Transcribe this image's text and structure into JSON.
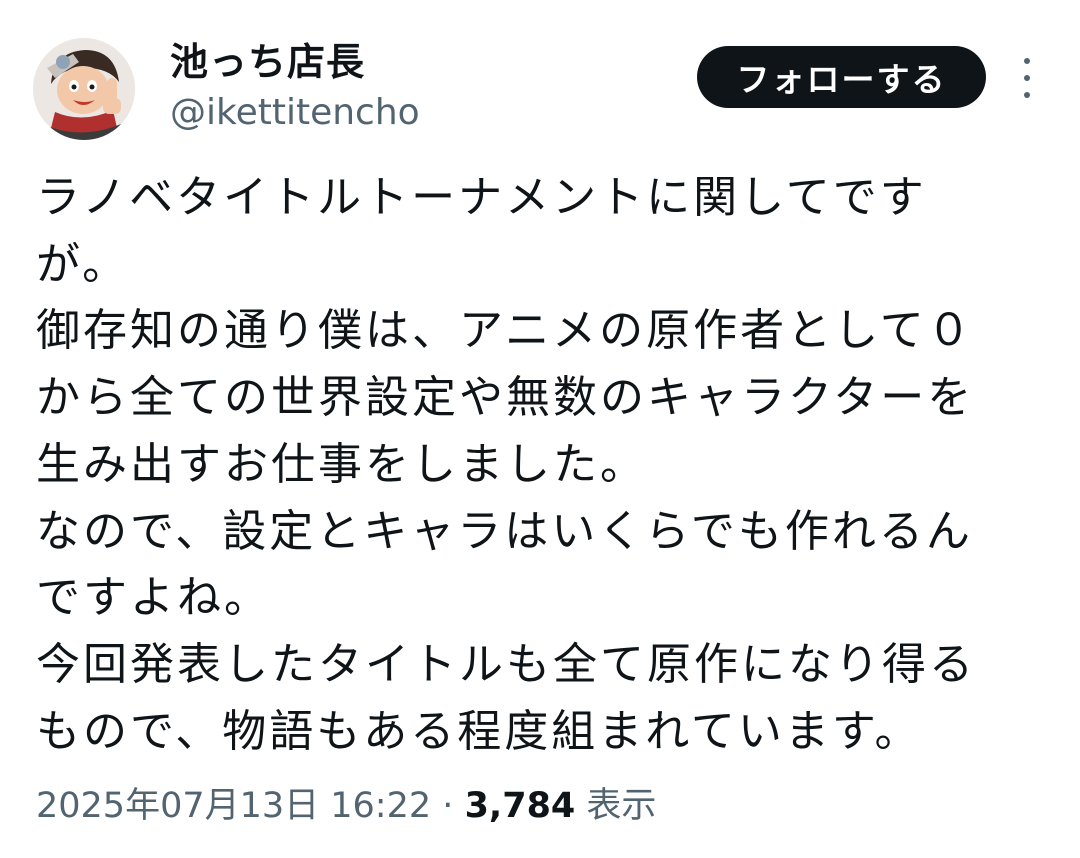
{
  "author": {
    "display_name": "池っち店長",
    "handle": "@ikettitencho"
  },
  "follow_button": {
    "label": "フォローする"
  },
  "more_button": {
    "icon": "more-vertical-icon"
  },
  "tweet": {
    "lines": [
      "ラノベタイトルトーナメントに関してです",
      "が。",
      "御存知の通り僕は、アニメの原作者として０",
      "から全ての世界設定や無数のキャラクターを",
      "生み出すお仕事をしました。",
      "なので、設定とキャラはいくらでも作れるん",
      "ですよね。",
      "今回発表したタイトルも全て原作になり得る",
      "もので、物語もある程度組まれています。"
    ],
    "timestamp": "2025年07月13日 16:22",
    "separator": "·",
    "views_count": "3,784",
    "views_label": "表示"
  },
  "colors": {
    "text_primary": "#0f1419",
    "text_secondary": "#536471",
    "button_bg": "#0f1419",
    "button_text": "#ffffff"
  }
}
